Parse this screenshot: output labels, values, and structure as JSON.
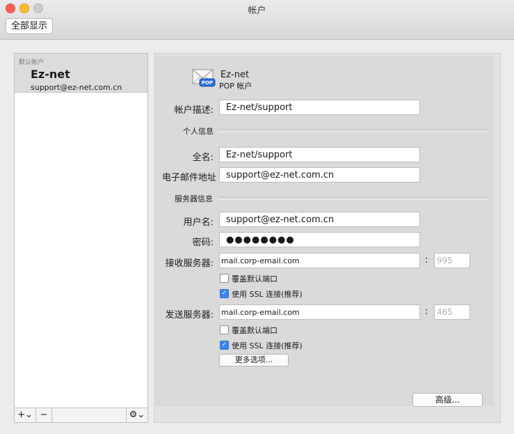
{
  "window": {
    "title": "帐户",
    "show_all_button": "全部显示"
  },
  "sidebar": {
    "group_label": "默认帐户",
    "account": {
      "name": "Ez-net",
      "email": "support@ez-net.com.cn"
    },
    "toolbar": {
      "add": "+⌄",
      "remove": "−",
      "gear": "⚙⌄"
    }
  },
  "account_header": {
    "name": "Ez-net",
    "type": "POP 帐户",
    "icon_badge": "POP"
  },
  "fields": {
    "description_label": "帐户描述:",
    "description_value": "Ez-net/support",
    "personal_section": "个人信息",
    "fullname_label": "全名:",
    "fullname_value": "Ez-net/support",
    "email_label": "电子邮件地址",
    "email_value": "support@ez-net.com.cn",
    "server_section": "服务器信息",
    "username_label": "用户名:",
    "username_value": "support@ez-net.com.cn",
    "password_label": "密码:",
    "password_value": "●●●●●●●●",
    "incoming_label": "接收服务器:",
    "incoming_value": "mail.corp-email.com",
    "incoming_port": "995",
    "incoming_override_label": "覆盖默认端口",
    "incoming_override_checked": false,
    "incoming_ssl_label": "使用 SSL 连接(推荐)",
    "incoming_ssl_checked": true,
    "outgoing_label": "发送服务器:",
    "outgoing_value": "mail.corp-email.com",
    "outgoing_port": "465",
    "outgoing_override_label": "覆盖默认端口",
    "outgoing_override_checked": false,
    "outgoing_ssl_label": "使用 SSL 连接(推荐)",
    "outgoing_ssl_checked": true,
    "colon": ":",
    "more_options_button": "更多选项...",
    "advanced_button": "高级..."
  },
  "icons": {
    "mail": "envelope-icon",
    "checkmark": "✓"
  }
}
